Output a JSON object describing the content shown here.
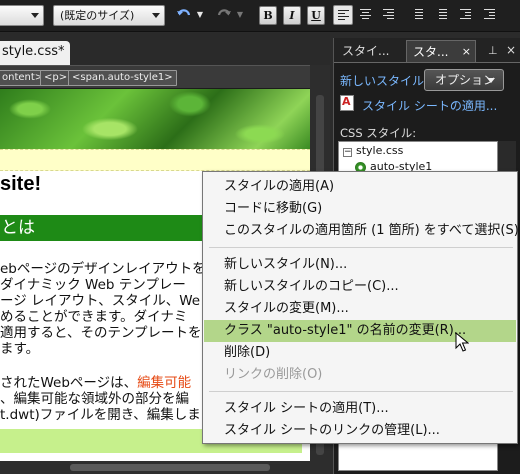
{
  "toolbar": {
    "font_select": "",
    "size_select": "(既定のサイズ)",
    "bold": "B",
    "italic": "I",
    "underline": "U",
    "undo_icon": "undo-arrow-icon",
    "redo_icon": "redo-arrow-icon"
  },
  "document": {
    "tab_label": "style.css*"
  },
  "tagbar": {
    "tags": [
      "ontent>",
      "<p>",
      "<span.auto-style1>"
    ]
  },
  "design": {
    "site_title": "site!",
    "green_heading": "とは",
    "paragraph1": [
      "ebページのデザインレイアウトを",
      "ダイナミック Web テンプレー",
      "ージ レイアウト、スタイル、We",
      "めることができます。ダイナミ",
      "適用すると、そのテンプレートを",
      "ます。"
    ],
    "paragraph2_prefix": "されたWebページは、",
    "paragraph2_highlight": "編集可能",
    "paragraph2": [
      "、編集可能な領域外の部分を編",
      "t.dwt)ファイルを開き、編集しま"
    ],
    "colors": {
      "green_heading_bg": "#1e8a16",
      "highlight_text": "#e64a14",
      "light_green_bar": "#c6f08c"
    }
  },
  "panel": {
    "tabs": [
      "スタイ...",
      "スタ..."
    ],
    "new_style_link": "新しいスタイル...",
    "options_button": "オプション",
    "apply_stylesheet_link": "スタイル シートの適用...",
    "css_styles_label": "CSS スタイル:",
    "tree": {
      "file": "style.css",
      "rule": "auto-style1"
    }
  },
  "context_menu": {
    "items": [
      {
        "label": "スタイルの適用(A)",
        "state": "normal"
      },
      {
        "label": "コードに移動(G)",
        "state": "normal"
      },
      {
        "label": "このスタイルの適用箇所 (1 箇所) をすべて選択(S)",
        "state": "normal"
      },
      {
        "label": "新しいスタイル(N)...",
        "state": "normal"
      },
      {
        "label": "新しいスタイルのコピー(C)...",
        "state": "normal"
      },
      {
        "label": "スタイルの変更(M)...",
        "state": "normal"
      },
      {
        "label": "クラス \"auto-style1\" の名前の変更(R)...",
        "state": "hover"
      },
      {
        "label": "削除(D)",
        "state": "normal"
      },
      {
        "label": "リンクの削除(O)",
        "state": "disabled"
      },
      {
        "label": "スタイル シートの適用(T)...",
        "state": "normal"
      },
      {
        "label": "スタイル シートのリンクの管理(L)...",
        "state": "normal"
      }
    ],
    "hover_color": "#b3d68a"
  }
}
